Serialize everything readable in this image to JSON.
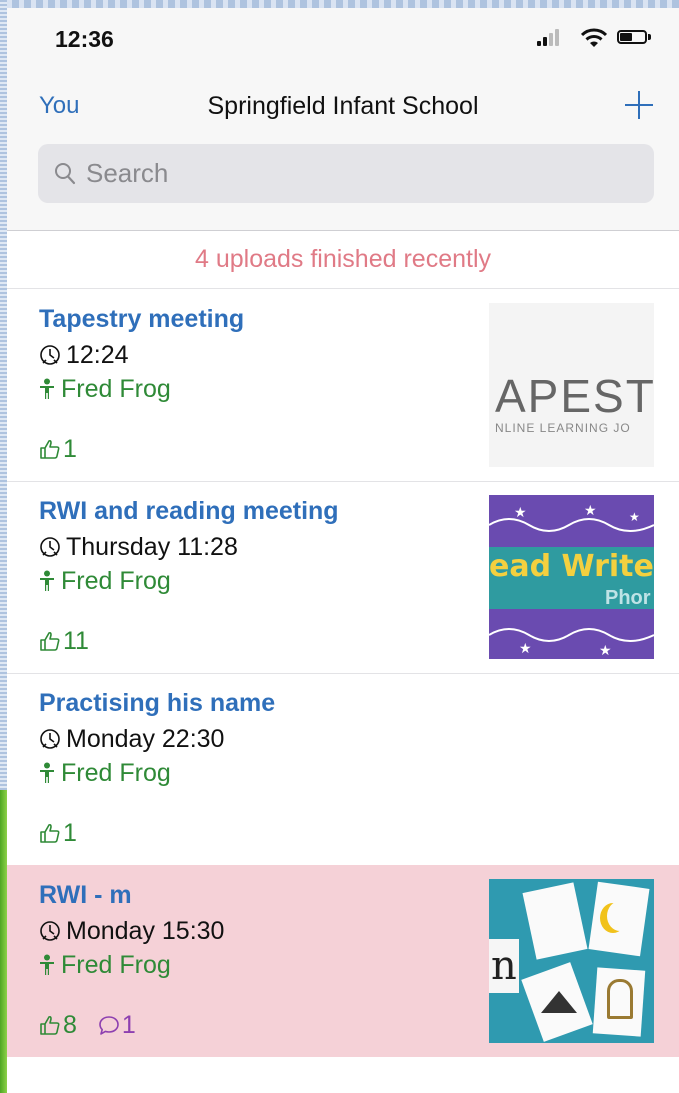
{
  "status_bar": {
    "time": "12:36"
  },
  "nav": {
    "left_label": "You",
    "title": "Springfield Infant School"
  },
  "search": {
    "placeholder": "Search"
  },
  "banner": {
    "text": "4 uploads finished recently"
  },
  "posts": [
    {
      "title": "Tapestry meeting",
      "time": "12:24",
      "child": "Fred Frog",
      "likes": "1",
      "comments": null,
      "highlighted": false,
      "thumbnail": {
        "text_main": "APEST",
        "text_sub": "NLINE LEARNING JO"
      }
    },
    {
      "title": "RWI and reading meeting",
      "time": "Thursday 11:28",
      "child": "Fred Frog",
      "likes": "11",
      "comments": null,
      "highlighted": false,
      "thumbnail": {
        "text_main": "ead Write",
        "text_sub": "Phor"
      }
    },
    {
      "title": "Practising his name",
      "time": "Monday 22:30",
      "child": "Fred Frog",
      "likes": "1",
      "comments": null,
      "highlighted": false,
      "thumbnail": null
    },
    {
      "title": "RWI - m",
      "time": "Monday 15:30",
      "child": "Fred Frog",
      "likes": "8",
      "comments": "1",
      "highlighted": true,
      "thumbnail": {
        "text_main": "n"
      }
    }
  ],
  "colors": {
    "accent": "#2f6fba",
    "child": "#2f8a37",
    "banner": "#e07a86",
    "highlight": "#f5d1d7",
    "comments": "#8d3fb0"
  }
}
